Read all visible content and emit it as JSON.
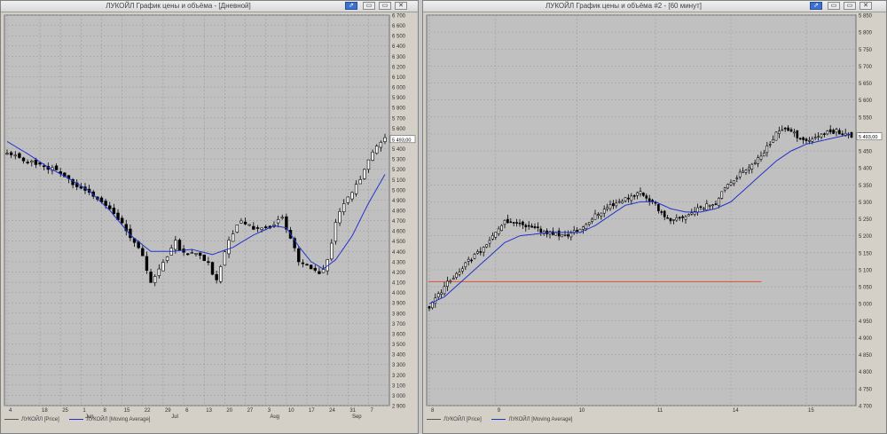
{
  "windows": {
    "left": {
      "title": "ЛУКОЙЛ График цены и объёма - [Дневной]",
      "buttons": {
        "pin": "⇗",
        "minimize": "▭",
        "maximize": "▭",
        "close": "✕"
      },
      "legend": {
        "price": "ЛУКОЙЛ [Price]",
        "ma": "ЛУКОЙЛ [Moving Average]"
      }
    },
    "right": {
      "title": "ЛУКОЙЛ График цены и объёма #2 - [60 минут]",
      "buttons": {
        "pin": "⇗",
        "minimize": "▭",
        "maximize": "▭",
        "close": "✕"
      },
      "legend": {
        "price": "ЛУКОЙЛ [Price]",
        "ma": "ЛУКОЙЛ [Moving Average]"
      }
    }
  },
  "colors": {
    "plot_bg": "#c0c0c0",
    "grid": "#9e9e9e",
    "candle": "#000000",
    "up_fill": "#ffffff",
    "moving_average": "#2233cc",
    "level_line": "#e05030",
    "axis_text": "#303030"
  },
  "chart_data": [
    {
      "type": "candlestick",
      "title": "ЛУКОЙЛ График цены и объёма - [Дневной]",
      "ylim": [
        2900,
        6700
      ],
      "y_ticks": [
        "6 700",
        "6 600",
        "6 500",
        "6 400",
        "6 300",
        "6 200",
        "6 100",
        "6 000",
        "5 900",
        "5 800",
        "5 700",
        "5 600",
        "5 500",
        "5 400",
        "5 300",
        "5 200",
        "5 100",
        "5 000",
        "4 900",
        "4 800",
        "4 700",
        "4 600",
        "4 500",
        "4 400",
        "4 300",
        "4 200",
        "4 100",
        "4 000",
        "3 900",
        "3 800",
        "3 700",
        "3 600",
        "3 500",
        "3 400",
        "3 300",
        "3 200",
        "3 100",
        "3 000",
        "2 900"
      ],
      "last_price_label": "5 493,00",
      "last_price": 5493,
      "x_tick_labels": [
        {
          "label": "4",
          "bar": 0
        },
        {
          "label": "18",
          "bar": 8
        },
        {
          "label": "25",
          "bar": 13
        },
        {
          "label": "1",
          "bar": 18
        },
        {
          "label": "8",
          "bar": 23
        },
        {
          "label": "15",
          "bar": 28
        },
        {
          "label": "22",
          "bar": 33
        },
        {
          "label": "29",
          "bar": 38
        },
        {
          "label": "6",
          "bar": 43
        },
        {
          "label": "13",
          "bar": 48
        },
        {
          "label": "20",
          "bar": 53
        },
        {
          "label": "27",
          "bar": 58
        },
        {
          "label": "3",
          "bar": 63
        },
        {
          "label": "10",
          "bar": 68
        },
        {
          "label": "17",
          "bar": 73
        },
        {
          "label": "24",
          "bar": 78
        },
        {
          "label": "31",
          "bar": 83
        },
        {
          "label": "7",
          "bar": 88
        }
      ],
      "month_labels": [
        {
          "label": "Jun",
          "bar": 19
        },
        {
          "label": "Jul",
          "bar": 40
        },
        {
          "label": "Aug",
          "bar": 64
        },
        {
          "label": "Sep",
          "bar": 84
        }
      ],
      "x_bars": 93,
      "price_anchors": [
        [
          0,
          5360
        ],
        [
          4,
          5290
        ],
        [
          8,
          5240
        ],
        [
          12,
          5180
        ],
        [
          16,
          5060
        ],
        [
          20,
          4960
        ],
        [
          24,
          4840
        ],
        [
          27,
          4720
        ],
        [
          30,
          4550
        ],
        [
          33,
          4380
        ],
        [
          35,
          4090
        ],
        [
          38,
          4290
        ],
        [
          41,
          4490
        ],
        [
          43,
          4370
        ],
        [
          46,
          4400
        ],
        [
          49,
          4290
        ],
        [
          51,
          4110
        ],
        [
          54,
          4530
        ],
        [
          57,
          4690
        ],
        [
          61,
          4610
        ],
        [
          64,
          4650
        ],
        [
          67,
          4720
        ],
        [
          69,
          4540
        ],
        [
          71,
          4310
        ],
        [
          74,
          4250
        ],
        [
          76,
          4170
        ],
        [
          78,
          4300
        ],
        [
          80,
          4680
        ],
        [
          82,
          4860
        ],
        [
          84,
          4990
        ],
        [
          86,
          5120
        ],
        [
          88,
          5290
        ],
        [
          90,
          5440
        ],
        [
          92,
          5493
        ]
      ],
      "moving_average_anchors": [
        [
          0,
          5470
        ],
        [
          5,
          5350
        ],
        [
          10,
          5220
        ],
        [
          15,
          5110
        ],
        [
          20,
          4990
        ],
        [
          25,
          4800
        ],
        [
          30,
          4560
        ],
        [
          35,
          4400
        ],
        [
          40,
          4400
        ],
        [
          45,
          4420
        ],
        [
          50,
          4370
        ],
        [
          55,
          4440
        ],
        [
          60,
          4560
        ],
        [
          65,
          4650
        ],
        [
          68,
          4630
        ],
        [
          71,
          4450
        ],
        [
          74,
          4300
        ],
        [
          77,
          4230
        ],
        [
          80,
          4320
        ],
        [
          84,
          4550
        ],
        [
          88,
          4870
        ],
        [
          92,
          5150
        ]
      ],
      "legend": [
        "ЛУКОЙЛ [Price]",
        "ЛУКОЙЛ [Moving Average]"
      ]
    },
    {
      "type": "candlestick",
      "title": "ЛУКОЙЛ График цены и объёма #2 - [60 минут]",
      "ylim": [
        4700,
        5850
      ],
      "y_ticks": [
        "5 850",
        "5 800",
        "5 750",
        "5 700",
        "5 650",
        "5 600",
        "5 550",
        "5 500",
        "5 450",
        "5 400",
        "5 350",
        "5 300",
        "5 250",
        "5 200",
        "5 150",
        "5 100",
        "5 050",
        "5 000",
        "4 950",
        "4 900",
        "4 850",
        "4 800",
        "4 750",
        "4 700"
      ],
      "last_price_label": "5 493,00",
      "last_price": 5493,
      "horizontal_level": 5065,
      "x_tick_labels": [
        {
          "label": "8",
          "bar": 0
        },
        {
          "label": "9",
          "bar": 22
        },
        {
          "label": "10",
          "bar": 49
        },
        {
          "label": "11",
          "bar": 75
        },
        {
          "label": "14",
          "bar": 100
        },
        {
          "label": "15",
          "bar": 125
        }
      ],
      "x_bars": 141,
      "price_anchors": [
        [
          0,
          4990
        ],
        [
          5,
          5050
        ],
        [
          10,
          5100
        ],
        [
          15,
          5140
        ],
        [
          20,
          5190
        ],
        [
          25,
          5240
        ],
        [
          30,
          5230
        ],
        [
          35,
          5220
        ],
        [
          40,
          5210
        ],
        [
          45,
          5200
        ],
        [
          50,
          5220
        ],
        [
          55,
          5260
        ],
        [
          60,
          5290
        ],
        [
          65,
          5310
        ],
        [
          70,
          5330
        ],
        [
          75,
          5290
        ],
        [
          80,
          5240
        ],
        [
          85,
          5260
        ],
        [
          90,
          5280
        ],
        [
          95,
          5300
        ],
        [
          100,
          5360
        ],
        [
          105,
          5400
        ],
        [
          110,
          5430
        ],
        [
          115,
          5500
        ],
        [
          118,
          5520
        ],
        [
          121,
          5500
        ],
        [
          125,
          5480
        ],
        [
          130,
          5500
        ],
        [
          135,
          5510
        ],
        [
          140,
          5493
        ]
      ],
      "moving_average_anchors": [
        [
          0,
          5000
        ],
        [
          5,
          5020
        ],
        [
          10,
          5060
        ],
        [
          15,
          5100
        ],
        [
          20,
          5140
        ],
        [
          25,
          5180
        ],
        [
          30,
          5200
        ],
        [
          40,
          5210
        ],
        [
          50,
          5210
        ],
        [
          55,
          5230
        ],
        [
          60,
          5260
        ],
        [
          65,
          5290
        ],
        [
          70,
          5300
        ],
        [
          75,
          5300
        ],
        [
          80,
          5280
        ],
        [
          85,
          5270
        ],
        [
          90,
          5270
        ],
        [
          95,
          5280
        ],
        [
          100,
          5300
        ],
        [
          105,
          5340
        ],
        [
          110,
          5380
        ],
        [
          115,
          5420
        ],
        [
          120,
          5450
        ],
        [
          125,
          5470
        ],
        [
          130,
          5480
        ],
        [
          135,
          5490
        ],
        [
          140,
          5500
        ]
      ],
      "legend": [
        "ЛУКОЙЛ [Price]",
        "ЛУКОЙЛ [Moving Average]"
      ]
    }
  ]
}
